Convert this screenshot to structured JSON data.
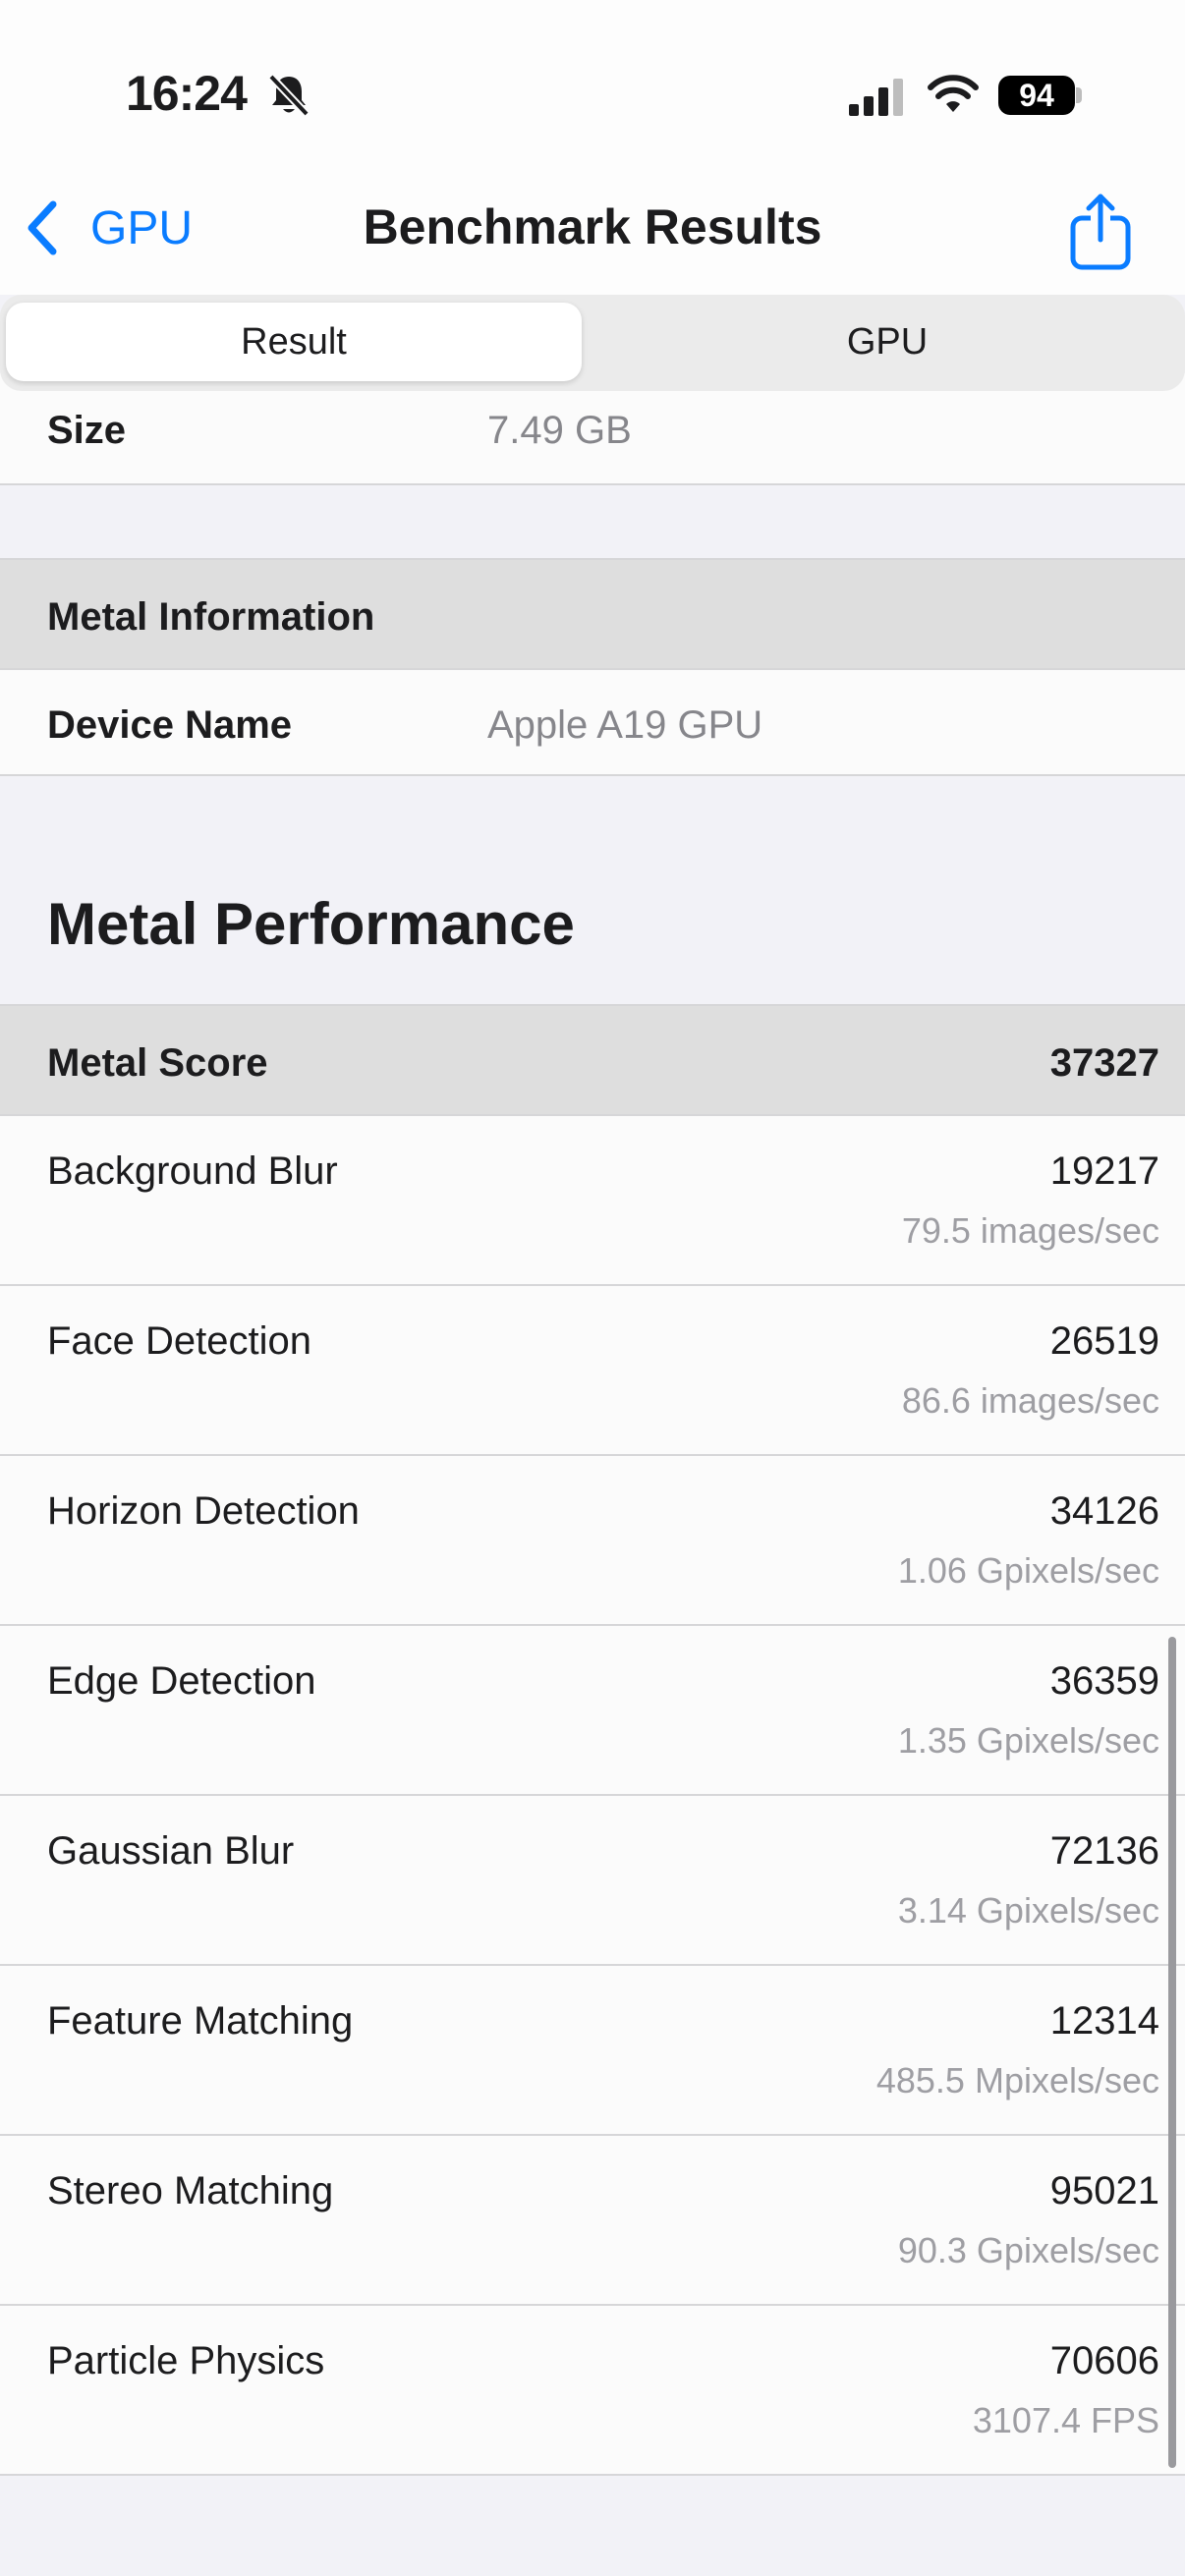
{
  "status_bar": {
    "time": "16:24",
    "battery": "94"
  },
  "nav": {
    "back_label": "GPU",
    "title": "Benchmark Results"
  },
  "segments": {
    "result": "Result",
    "gpu": "GPU"
  },
  "size_row": {
    "label": "Size",
    "value": "7.49 GB"
  },
  "metal_info": {
    "header": "Metal Information",
    "device_label": "Device Name",
    "device_value": "Apple A19 GPU"
  },
  "metal_performance": {
    "title": "Metal Performance",
    "score_label": "Metal Score",
    "score_value": "37327",
    "tests": [
      {
        "name": "Background Blur",
        "score": "19217",
        "rate": "79.5 images/sec"
      },
      {
        "name": "Face Detection",
        "score": "26519",
        "rate": "86.6 images/sec"
      },
      {
        "name": "Horizon Detection",
        "score": "34126",
        "rate": "1.06 Gpixels/sec"
      },
      {
        "name": "Edge Detection",
        "score": "36359",
        "rate": "1.35 Gpixels/sec"
      },
      {
        "name": "Gaussian Blur",
        "score": "72136",
        "rate": "3.14 Gpixels/sec"
      },
      {
        "name": "Feature Matching",
        "score": "12314",
        "rate": "485.5 Mpixels/sec"
      },
      {
        "name": "Stereo Matching",
        "score": "95021",
        "rate": "90.3 Gpixels/sec"
      },
      {
        "name": "Particle Physics",
        "score": "70606",
        "rate": "3107.4 FPS"
      }
    ]
  },
  "colors": {
    "accent": "#0a7cff",
    "header_bg": "#dedede",
    "secondary_text": "#86868b"
  },
  "icons": [
    "bell-slash-icon",
    "cellular-signal-icon",
    "wifi-icon",
    "battery-icon",
    "chevron-left-icon",
    "share-icon"
  ]
}
